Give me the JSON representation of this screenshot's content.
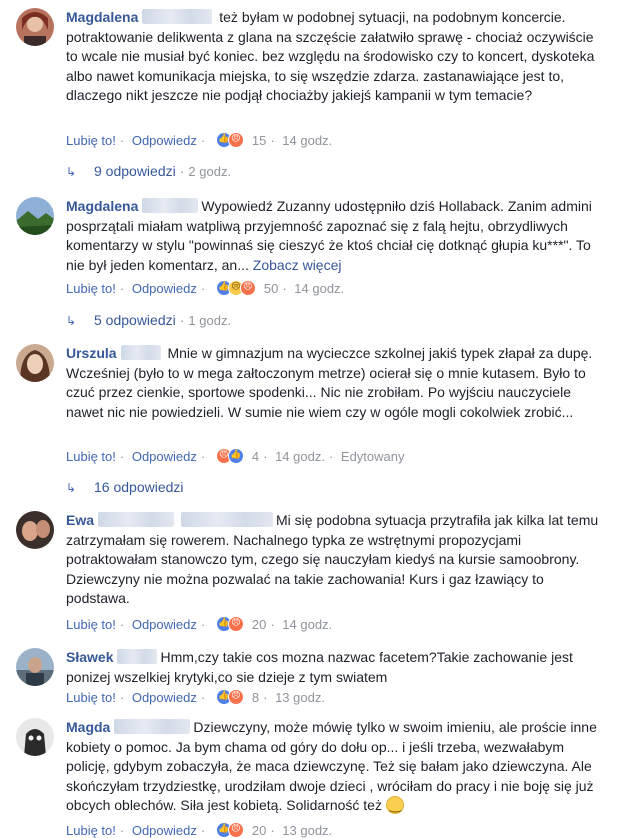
{
  "comments": [
    {
      "author": "Magdalena",
      "text": "też byłam w podobnej sytuacji, na podobnym koncercie. potraktowanie delikwenta z glana na szczęście załatwiło sprawę - chociaż oczywiście to wcale nie musiał być koniec. bez względu na środowisko czy to koncert, dyskoteka albo nawet komunikacja miejska, to się wszędzie zdarza. zastanawiające jest to, dlaczego nikt jeszcze nie podjął chociażby jakiejś kampanii w tym temacie?",
      "like_label": "Lubię to!",
      "reply_label": "Odpowiedz",
      "reactions": [
        "like",
        "angry"
      ],
      "reaction_count": "15",
      "time": "14 godz.",
      "replies_label": "9 odpowiedzi",
      "replies_time": "2 godz."
    },
    {
      "author": "Magdalena",
      "text": "Wypowiedź Zuzanny udostępniło dziś Hollaback. Zanim admini posprzątali miałam watpliwą przyjemność zapoznać się z falą hejtu, obrzydliwych komentarzy w stylu \"powinnaś się cieszyć że ktoś chciał cię dotknąć głupia ku***\". To nie był jeden komentarz, an...",
      "more_label": "Zobacz więcej",
      "like_label": "Lubię to!",
      "reply_label": "Odpowiedz",
      "reactions": [
        "like",
        "sad",
        "angry"
      ],
      "reaction_count": "50",
      "time": "14 godz.",
      "replies_label": "5 odpowiedzi",
      "replies_time": "1 godz."
    },
    {
      "author": "Urszula",
      "text": "Mnie w gimnazjum na wycieczce szkolnej jakiś typek złapał za dupę. Wcześniej (było to w mega załtoczonym metrze) ocierał się o mnie kutasem. Było to czuć przez cienkie, sportowe spodenki... Nic nie zrobiłam. Po wyjściu nauczyciele nawet nic nie powiedzieli. W sumie nie wiem czy w ogóle mogli cokolwiek zrobić...",
      "like_label": "Lubię to!",
      "reply_label": "Odpowiedz",
      "reactions": [
        "angry",
        "like"
      ],
      "reaction_count": "4",
      "time": "14 godz.",
      "edited_label": "Edytowany",
      "replies_label": "16 odpowiedzi"
    },
    {
      "author": "Ewa",
      "text": "Mi się podobna sytuacja przytrafiła jak kilka lat temu zatrzymałam się rowerem. Nachalnego typka ze wstrętnymi propozycjami potraktowałam stanowczo tym, czego się nauczyłam kiedyś na kursie samoobrony. Dziewczyny nie można pozwalać na takie zachowania! Kurs i gaz łzawiący to podstawa.",
      "like_label": "Lubię to!",
      "reply_label": "Odpowiedz",
      "reactions": [
        "like",
        "angry"
      ],
      "reaction_count": "20",
      "time": "14 godz."
    },
    {
      "author": "Sławek",
      "text": "Hmm,czy takie cos mozna nazwac facetem?Takie zachowanie jest ponizej wszelkiej krytyki,co sie dzieje z tym swiatem",
      "like_label": "Lubię to!",
      "reply_label": "Odpowiedz",
      "reactions": [
        "like",
        "angry"
      ],
      "reaction_count": "8",
      "time": "13 godz."
    },
    {
      "author": "Magda",
      "text": "Dziewczyny, może mówię tylko w swoim imieniu, ale proście inne kobiety o pomoc. Ja bym chama od góry do dołu op... i jeśli trzeba, wezwałabym policję, gdybym zobaczyła, że maca dziewczynę. Też się bałam jako dziewczyna. Ale skończyłam trzydziestkę, urodziłam dwoje dzieci , wróciłam do pracy i nie boję się już obcych oblechów. Siła jest kobietą. Solidarność też",
      "like_label": "Lubię to!",
      "reply_label": "Odpowiedz",
      "reactions": [
        "like",
        "angry"
      ],
      "reaction_count": "20",
      "time": "13 godz."
    }
  ],
  "icons": {
    "like": "👍",
    "love": "♥",
    "angry": "😠",
    "sad": "😢",
    "reply_arrow": "↳"
  },
  "colors": {
    "link": "#365899",
    "meta": "#90949c",
    "like": "#4f7fe8",
    "angry": "#f7714c"
  }
}
